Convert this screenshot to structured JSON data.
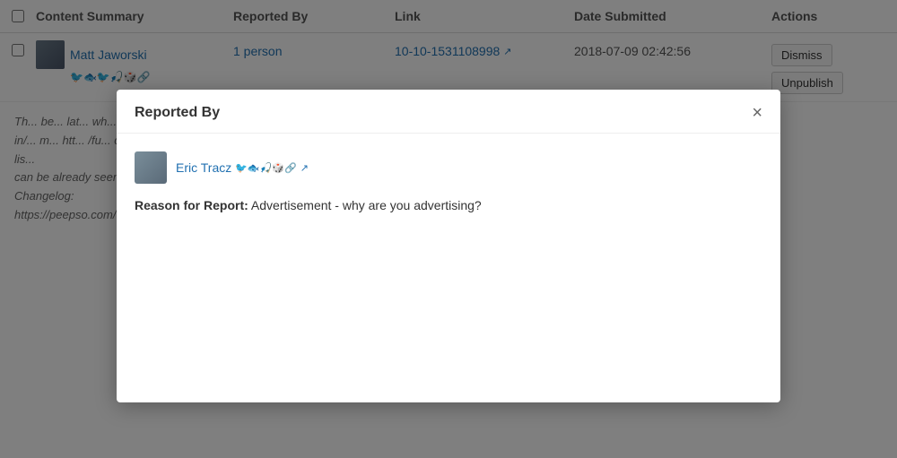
{
  "table": {
    "headers": {
      "checkbox": "",
      "content_summary": "Content Summary",
      "reported_by": "Reported By",
      "link": "Link",
      "date_submitted": "Date Submitted",
      "actions": "Actions"
    },
    "rows": [
      {
        "user_name": "Matt Jaworski",
        "user_icons": "🐦🐟🐦🎣🎲🔗",
        "reported_by": "1 person",
        "link": "10-10-1531108998",
        "date": "2018-07-09 02:42:56",
        "action_dismiss": "Dismiss",
        "action_unpublish": "Unpublish"
      }
    ]
  },
  "background_text": "Th... be... lat... wh... rig... fil... po... in/... m... htt... /fu... co... th... ca... lis... can be already seen in the Changelog: https://peepso.com/cha...",
  "modal": {
    "title": "Reported By",
    "close_icon": "×",
    "reporter": {
      "name": "Eric Tracz",
      "icons": "🐦🐟🎣🎲🔗"
    },
    "reason_label": "Reason for Report:",
    "reason_text": "Advertisement - why are you advertising?"
  }
}
